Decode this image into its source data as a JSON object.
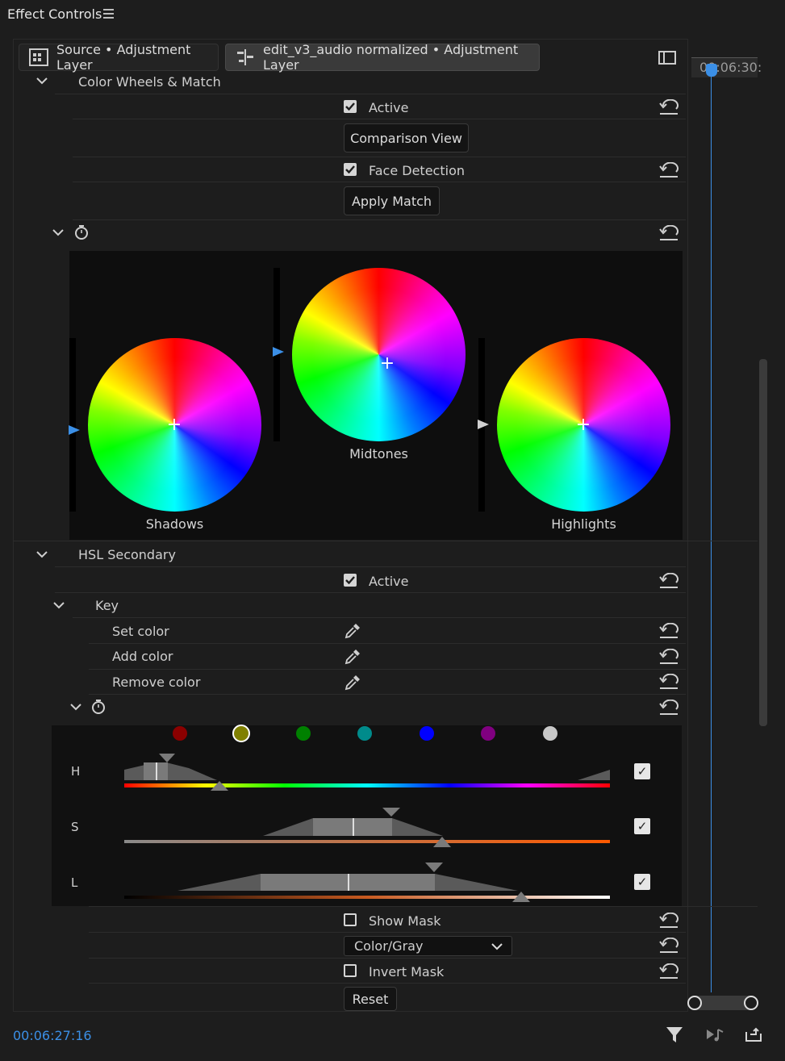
{
  "panel": {
    "title": "Effect Controls"
  },
  "tabs": [
    {
      "label": "Source • Adjustment Layer"
    },
    {
      "label": "edit_v3_audio normalized • Adjustment Layer"
    }
  ],
  "timeline": {
    "timecode_top": "00:06:30:"
  },
  "color_wheels_section": {
    "title": "Color Wheels & Match",
    "active_label": "Active",
    "comparison_button": "Comparison View",
    "face_detection_label": "Face Detection",
    "apply_match_button": "Apply Match",
    "wheels": [
      {
        "label": "Shadows"
      },
      {
        "label": "Midtones"
      },
      {
        "label": "Highlights"
      }
    ]
  },
  "hsl_section": {
    "title": "HSL Secondary",
    "active_label": "Active",
    "key_label": "Key",
    "set_color_label": "Set color",
    "add_color_label": "Add color",
    "remove_color_label": "Remove color",
    "swatches": [
      "#8b0000",
      "#808000",
      "#008000",
      "#008b8b",
      "#0000ff",
      "#800080",
      "#c8c8c8"
    ],
    "selected_swatch": 1,
    "channels": [
      {
        "letter": "H"
      },
      {
        "letter": "S"
      },
      {
        "letter": "L"
      }
    ],
    "show_mask_label": "Show Mask",
    "mask_mode": "Color/Gray",
    "invert_mask_label": "Invert Mask",
    "reset_button": "Reset"
  },
  "footer": {
    "timecode": "00:06:27:16"
  },
  "colors": {
    "accent": "#3b8fe6"
  }
}
